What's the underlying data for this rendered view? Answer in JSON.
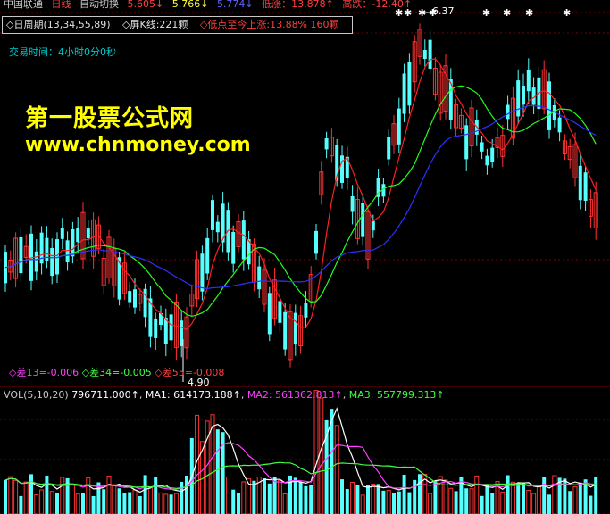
{
  "header": {
    "stock_name": "中国联通",
    "period": "日线",
    "auto": "自动切换",
    "v1": "5.605↓",
    "v2": "5.766↓",
    "v3": "5.774↓",
    "low_rise": "低涨：13.878↑",
    "high_drop": "高跌：-12.40↑"
  },
  "info": {
    "period": "◇日周期(13,34,55,89)",
    "screen_k": "◇屏K线:221颗",
    "low_rise": "◇低点至今上涨:13.88% 160颗"
  },
  "trade_time": "交易时间：4小时0分0秒",
  "watermark": {
    "title": "第一股票公式网",
    "url": "www.chnmoney.com"
  },
  "diff": {
    "d13": "◇差13=-0.006",
    "d34": "◇差34=-0.005",
    "d55": "◇差55=-0.008"
  },
  "markers": {
    "low": "4.90",
    "high": "6.37"
  },
  "volume": {
    "label": "VOL(5,10,20)",
    "vol": "796711.000↑",
    "ma1": "MA1: 614173.188↑",
    "ma2": "MA2: 561362.813↑",
    "ma3": "MA3: 557799.313↑"
  },
  "colors": {
    "up": "#ff3232",
    "down": "#54ffff",
    "ma_red": "#ff2020",
    "ma_green": "#20ff20",
    "ma_blue": "#3030ff",
    "vol_white": "#ffffff",
    "vol_magenta": "#ff40ff",
    "vol_green": "#40ff40",
    "grid": "#800000"
  }
}
